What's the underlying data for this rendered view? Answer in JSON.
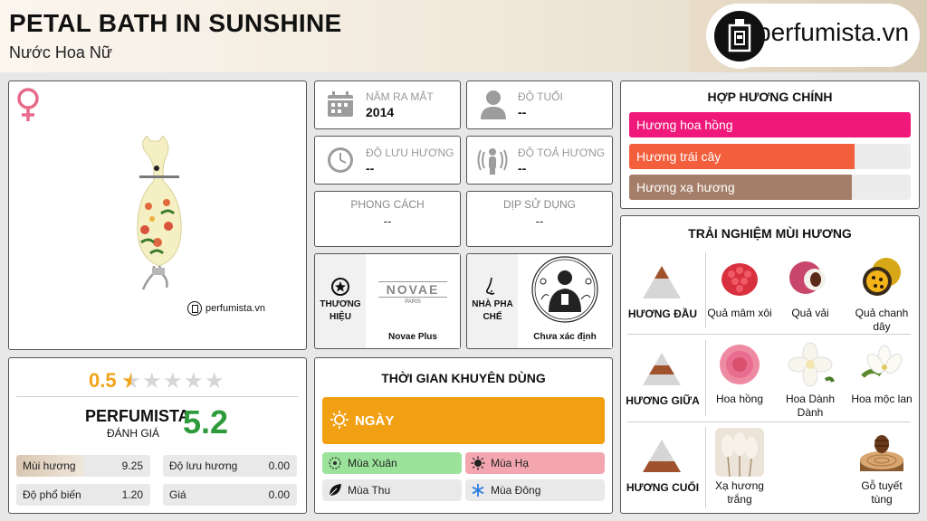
{
  "header": {
    "title": "PETAL BATH IN SUNSHINE",
    "subtitle": "Nước Hoa Nữ",
    "logo_text": "perfumista.vn"
  },
  "product": {
    "watermark": "perfumista.vn",
    "gender_icon": "female-symbol-icon"
  },
  "info": {
    "year_label": "NĂM RA MẮT",
    "year_value": "2014",
    "age_label": "ĐỘ TUỔI",
    "age_value": "--",
    "longevity_label": "ĐỘ LƯU HƯƠNG",
    "longevity_value": "--",
    "sillage_label": "ĐỘ TOẢ HƯƠNG",
    "sillage_value": "--",
    "style_label": "PHONG CÁCH",
    "style_value": "--",
    "occasion_label": "DỊP SỬ DỤNG",
    "occasion_value": "--",
    "brand_label": "THƯƠNG HIỆU",
    "brand_name": "Novae Plus",
    "brand_logo_text": "NOVAE",
    "brand_logo_sub": "PARIS",
    "perfumer_label": "NHÀ PHA CHẾ",
    "perfumer_name": "Chưa xác định"
  },
  "rating": {
    "value": "0.5",
    "stars_total": 5,
    "stars_filled": 0.5,
    "pf_title": "PERFUMISTA",
    "pf_sub": "ĐÁNH GIÁ",
    "pf_score": "5.2",
    "metrics": [
      {
        "label": "Mùi hương",
        "value": "9.25",
        "fill": 0.5
      },
      {
        "label": "Độ lưu hương",
        "value": "0.00",
        "fill": 0
      },
      {
        "label": "Độ phổ biến",
        "value": "1.20",
        "fill": 0
      },
      {
        "label": "Giá",
        "value": "0.00",
        "fill": 0
      }
    ]
  },
  "time": {
    "title": "THỜI GIAN KHUYÊN DÙNG",
    "day_label": "NGÀY",
    "seasons": [
      {
        "label": "Mùa Xuân",
        "color": "#9be39b",
        "icon": "flower-icon"
      },
      {
        "label": "Mùa Hạ",
        "color": "#f3a6b0",
        "icon": "sun-icon"
      },
      {
        "label": "Mùa Thu",
        "color": "#e9e9e9",
        "icon": "leaf-icon"
      },
      {
        "label": "Mùa Đông",
        "color": "#e9e9e9",
        "icon": "snowflake-icon"
      }
    ]
  },
  "accords": {
    "title": "HỢP HƯƠNG CHÍNH",
    "items": [
      {
        "label": "Hương hoa hồng",
        "color": "#f0187a",
        "fill": 1.0
      },
      {
        "label": "Hương trái cây",
        "color": "#f35f3c",
        "fill": 0.8
      },
      {
        "label": "Hương xạ hương",
        "color": "#a57e6a",
        "fill": 0.79
      }
    ]
  },
  "notes": {
    "title": "TRẢI NGHIỆM MÙI HƯƠNG",
    "tiers": [
      {
        "label": "HƯƠNG ĐẦU",
        "items": [
          "Quả mâm xôi",
          "Quả vải",
          "Quả chanh dây"
        ]
      },
      {
        "label": "HƯƠNG GIỮA",
        "items": [
          "Hoa hồng",
          "Hoa Dành Dành",
          "Hoa mộc lan"
        ]
      },
      {
        "label": "HƯƠNG CUỐI",
        "items": [
          "Xạ hương trắng",
          "Gỗ tuyết tùng"
        ]
      }
    ]
  }
}
